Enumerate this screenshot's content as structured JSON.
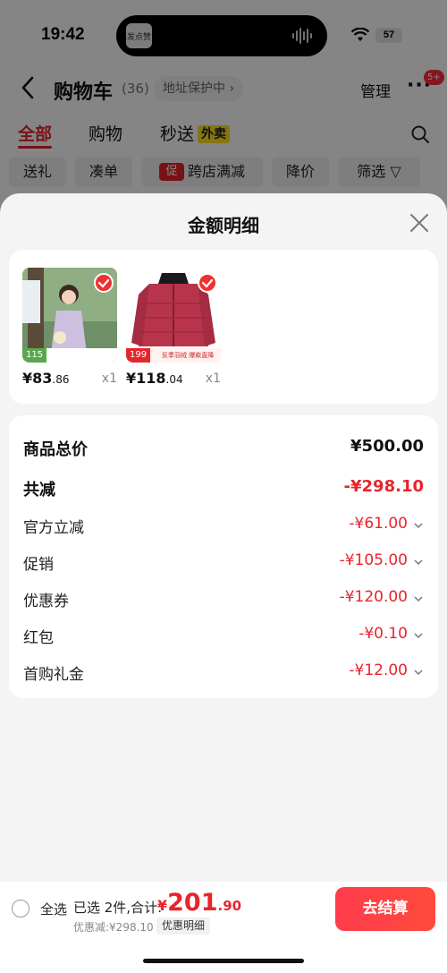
{
  "status_bar": {
    "time": "19:42",
    "battery": "57",
    "island_thumb": "发点赞"
  },
  "nav": {
    "title": "购物车",
    "count": "(36)",
    "address": "地址保护中 ›",
    "manage": "管理",
    "more": "···",
    "more_badge": "5+"
  },
  "tabs": [
    {
      "label": "全部",
      "active": true
    },
    {
      "label": "购物"
    },
    {
      "label": "秒送",
      "tag": "外卖"
    }
  ],
  "filters": [
    {
      "label": "送礼"
    },
    {
      "label": "凑单"
    },
    {
      "label": "跨店满减",
      "mark": "促"
    },
    {
      "label": "降价"
    },
    {
      "label": "筛选 ▽"
    }
  ],
  "sheet": {
    "title": "金额明细",
    "goods": [
      {
        "price_int": "¥83",
        "price_dec": ".86",
        "qty": "x1",
        "tag": "115",
        "image": "woman-in-dress"
      },
      {
        "price_int": "¥118",
        "price_dec": ".04",
        "qty": "x1",
        "tag": "199",
        "strip": "反季羽绒 爆款直降",
        "image": "red-down-jacket"
      }
    ],
    "detail": [
      {
        "label": "商品总价",
        "value": "¥500.00",
        "kind": "total"
      },
      {
        "label": "共减",
        "value": "-¥298.10",
        "kind": "discount-total"
      },
      {
        "label": "官方立减",
        "value": "-¥61.00"
      },
      {
        "label": "促销",
        "value": "-¥105.00"
      },
      {
        "label": "优惠券",
        "value": "-¥120.00"
      },
      {
        "label": "红包",
        "value": "-¥0.10"
      },
      {
        "label": "首购礼金",
        "value": "-¥12.00"
      }
    ]
  },
  "bottom_bar": {
    "select_all": "全选",
    "selected": "已选 2件,合计:",
    "sum_currency": "¥",
    "sum_int": "201",
    "sum_dec": ".90",
    "discount_text": "优惠减:¥298.10",
    "detail_chip": "优惠明细",
    "checkout": "去结算"
  },
  "colors": {
    "accent": "#e8242c",
    "sheet_bg": "#f4f4f4",
    "takeout_tag": "#ffe21e"
  }
}
